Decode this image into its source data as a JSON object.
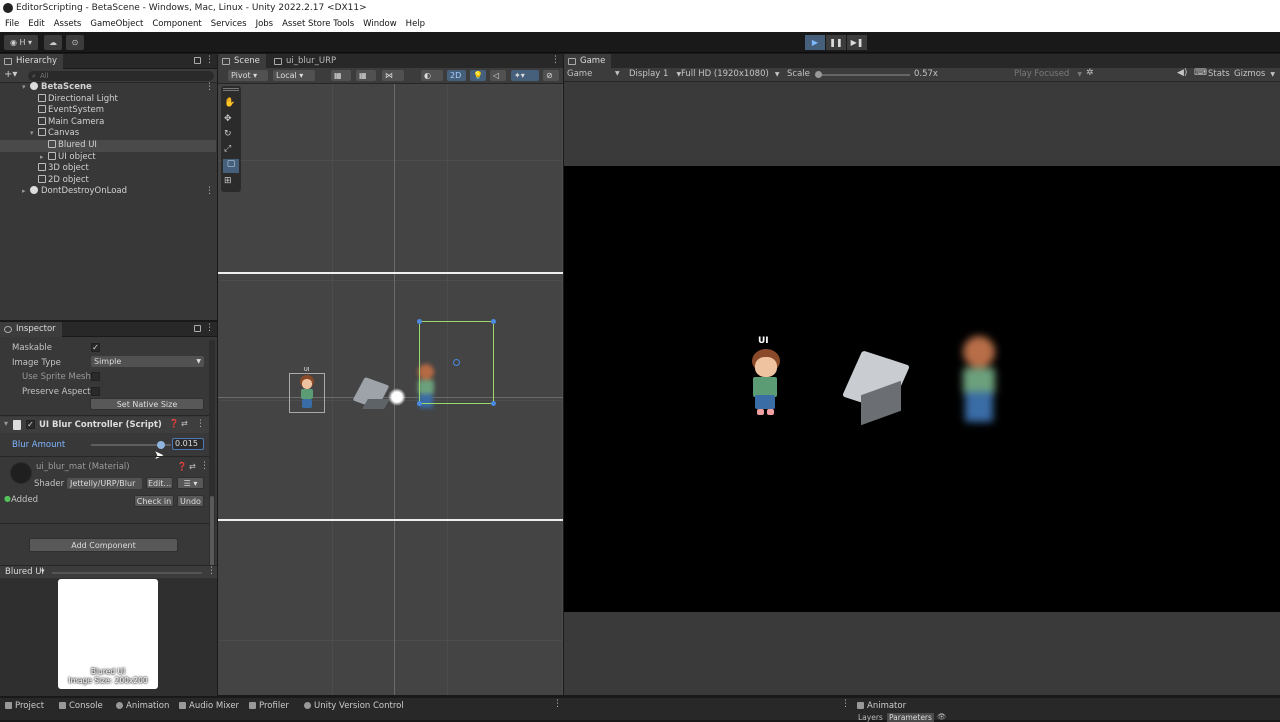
{
  "window": {
    "title": "EditorScripting - BetaScene - Windows, Mac, Linux - Unity 2022.2.17 <DX11>"
  },
  "menu": [
    "File",
    "Edit",
    "Assets",
    "GameObject",
    "Component",
    "Services",
    "Jobs",
    "Asset Store Tools",
    "Window",
    "Help"
  ],
  "toolbar": {
    "account_label": "H",
    "play_active": true,
    "play_icon": "▶",
    "pause_icon": "❚❚",
    "step_icon": "▶❚"
  },
  "hierarchy": {
    "tab": "Hierarchy",
    "search_placeholder": "All",
    "items": [
      {
        "label": "BetaScene",
        "bold": true,
        "icon": "unity-scene-icon"
      },
      {
        "label": "Directional Light",
        "icon": "gameobject-icon"
      },
      {
        "label": "EventSystem",
        "icon": "gameobject-icon"
      },
      {
        "label": "Main Camera",
        "icon": "gameobject-icon"
      },
      {
        "label": "Canvas",
        "icon": "gameobject-icon",
        "expanded": true
      },
      {
        "label": "Blured UI",
        "icon": "gameobject-icon",
        "selected": true
      },
      {
        "label": "UI object",
        "icon": "gameobject-icon"
      },
      {
        "label": "3D object",
        "icon": "gameobject-icon"
      },
      {
        "label": "2D object",
        "icon": "gameobject-icon"
      },
      {
        "label": "DontDestroyOnLoad",
        "icon": "unity-scene-icon"
      }
    ]
  },
  "inspector": {
    "tab": "Inspector",
    "maskable_label": "Maskable",
    "maskable_checked": true,
    "image_type_label": "Image Type",
    "image_type_value": "Simple",
    "use_sprite_mesh_label": "Use Sprite Mesh",
    "preserve_aspect_label": "Preserve Aspect",
    "set_native_size": "Set Native Size",
    "component_title": "UI Blur Controller (Script)",
    "blur_label": "Blur Amount",
    "blur_value": "0.015",
    "blur_fraction": 0.88,
    "material_name": "ui_blur_mat (Material)",
    "shader_label": "Shader",
    "shader_value": "Jettelly/URP/Blur",
    "edit_button": "Edit...",
    "added_label": "Added",
    "check_in": "Check in",
    "undo": "Undo",
    "add_component": "Add Component",
    "preview_header": "Blured UI",
    "preview_caption_1": "Blured UI",
    "preview_caption_2": "Image Size: 200x200"
  },
  "scene": {
    "tabs": [
      "Scene",
      "ui_blur_URP"
    ],
    "pivot": "Pivot",
    "local": "Local",
    "mode_2d": "2D",
    "ui_label": "UI"
  },
  "game": {
    "tab": "Game",
    "view_mode": "Game",
    "display": "Display 1",
    "resolution": "Full HD (1920x1080)",
    "scale_label": "Scale",
    "scale_value": "0.57x",
    "play_focused": "Play Focused",
    "stats": "Stats",
    "gizmos": "Gizmos",
    "ui_label": "UI"
  },
  "bottom": {
    "tabs": [
      "Project",
      "Console",
      "Animation",
      "Audio Mixer",
      "Profiler",
      "Unity Version Control"
    ],
    "animator_tab": "Animator",
    "animator_subtabs": [
      "Layers",
      "Parameters"
    ]
  }
}
